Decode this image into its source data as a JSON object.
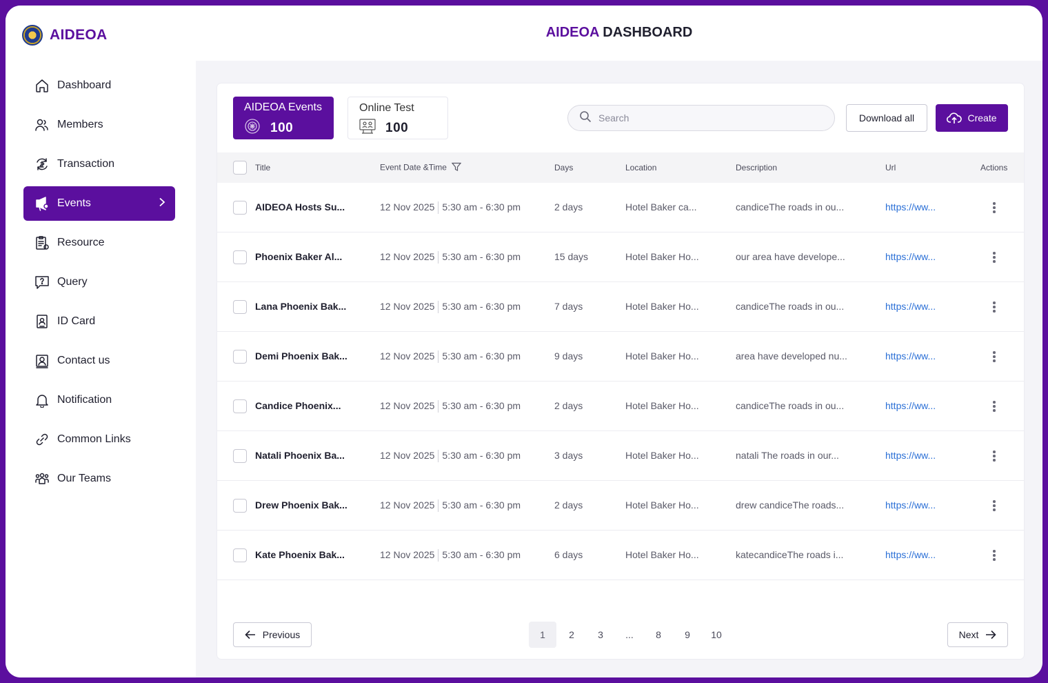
{
  "brand": {
    "name": "AIDEOA"
  },
  "header": {
    "title_brand": "AIDEOA",
    "title_rest": " DASHBOARD"
  },
  "sidebar": {
    "items": [
      {
        "label": "Dashboard",
        "icon": "home-icon"
      },
      {
        "label": "Members",
        "icon": "users-icon"
      },
      {
        "label": "Transaction",
        "icon": "transaction-icon"
      },
      {
        "label": "Events",
        "icon": "megaphone-icon",
        "active": true
      },
      {
        "label": "Resource",
        "icon": "clipboard-icon"
      },
      {
        "label": "Query",
        "icon": "question-icon"
      },
      {
        "label": "ID Card",
        "icon": "id-card-icon"
      },
      {
        "label": "Contact us",
        "icon": "contact-icon"
      },
      {
        "label": "Notification",
        "icon": "bell-icon"
      },
      {
        "label": "Common Links",
        "icon": "link-icon"
      },
      {
        "label": "Our Teams",
        "icon": "team-icon"
      }
    ]
  },
  "stats": [
    {
      "label": "AIDEOA Events",
      "value": "100"
    },
    {
      "label": "Online Test",
      "value": "100"
    }
  ],
  "search": {
    "placeholder": "Search"
  },
  "toolbar": {
    "download_label": "Download all",
    "create_label": "Create"
  },
  "table": {
    "headers": {
      "title": "Title",
      "date": "Event  Date &Time",
      "days": "Days",
      "location": "Location",
      "description": "Description",
      "url": "Url",
      "actions": "Actions"
    },
    "rows": [
      {
        "title": "AIDEOA Hosts Su...",
        "date": "12 Nov 2025",
        "time": "5:30 am - 6:30 pm",
        "days": "2 days",
        "location": "Hotel Baker ca...",
        "description": "candiceThe roads in ou...",
        "url": "https://ww..."
      },
      {
        "title": "Phoenix Baker Al...",
        "date": "12 Nov 2025",
        "time": "5:30 am - 6:30 pm",
        "days": "15 days",
        "location": "Hotel Baker Ho...",
        "description": "our area have develope...",
        "url": "https://ww..."
      },
      {
        "title": "Lana Phoenix Bak...",
        "date": "12 Nov 2025",
        "time": "5:30 am - 6:30 pm",
        "days": "7 days",
        "location": "Hotel Baker Ho...",
        "description": "candiceThe roads in ou...",
        "url": "https://ww..."
      },
      {
        "title": "Demi Phoenix Bak...",
        "date": "12 Nov 2025",
        "time": "5:30 am - 6:30 pm",
        "days": "9 days",
        "location": "Hotel Baker Ho...",
        "description": "area have developed nu...",
        "url": "https://ww..."
      },
      {
        "title": "Candice Phoenix...",
        "date": "12 Nov 2025",
        "time": "5:30 am - 6:30 pm",
        "days": "2 days",
        "location": "Hotel Baker Ho...",
        "description": "candiceThe roads in ou...",
        "url": "https://ww..."
      },
      {
        "title": "Natali Phoenix Ba...",
        "date": "12 Nov 2025",
        "time": "5:30 am - 6:30 pm",
        "days": "3 days",
        "location": "Hotel Baker Ho...",
        "description": "natali The roads in our...",
        "url": "https://ww..."
      },
      {
        "title": "Drew Phoenix Bak...",
        "date": "12 Nov 2025",
        "time": "5:30 am - 6:30 pm",
        "days": "2 days",
        "location": "Hotel Baker Ho...",
        "description": "drew candiceThe roads...",
        "url": "https://ww..."
      },
      {
        "title": "Kate Phoenix Bak...",
        "date": "12 Nov 2025",
        "time": "5:30 am - 6:30 pm",
        "days": "6 days",
        "location": "Hotel Baker Ho...",
        "description": "katecandiceThe roads i...",
        "url": "https://ww..."
      }
    ]
  },
  "pagination": {
    "prev_label": "Previous",
    "next_label": "Next",
    "pages": [
      "1",
      "2",
      "3",
      "...",
      "8",
      "9",
      "10"
    ],
    "current": "1"
  },
  "colors": {
    "accent": "#5b0f9e",
    "link": "#2a6fd6"
  }
}
